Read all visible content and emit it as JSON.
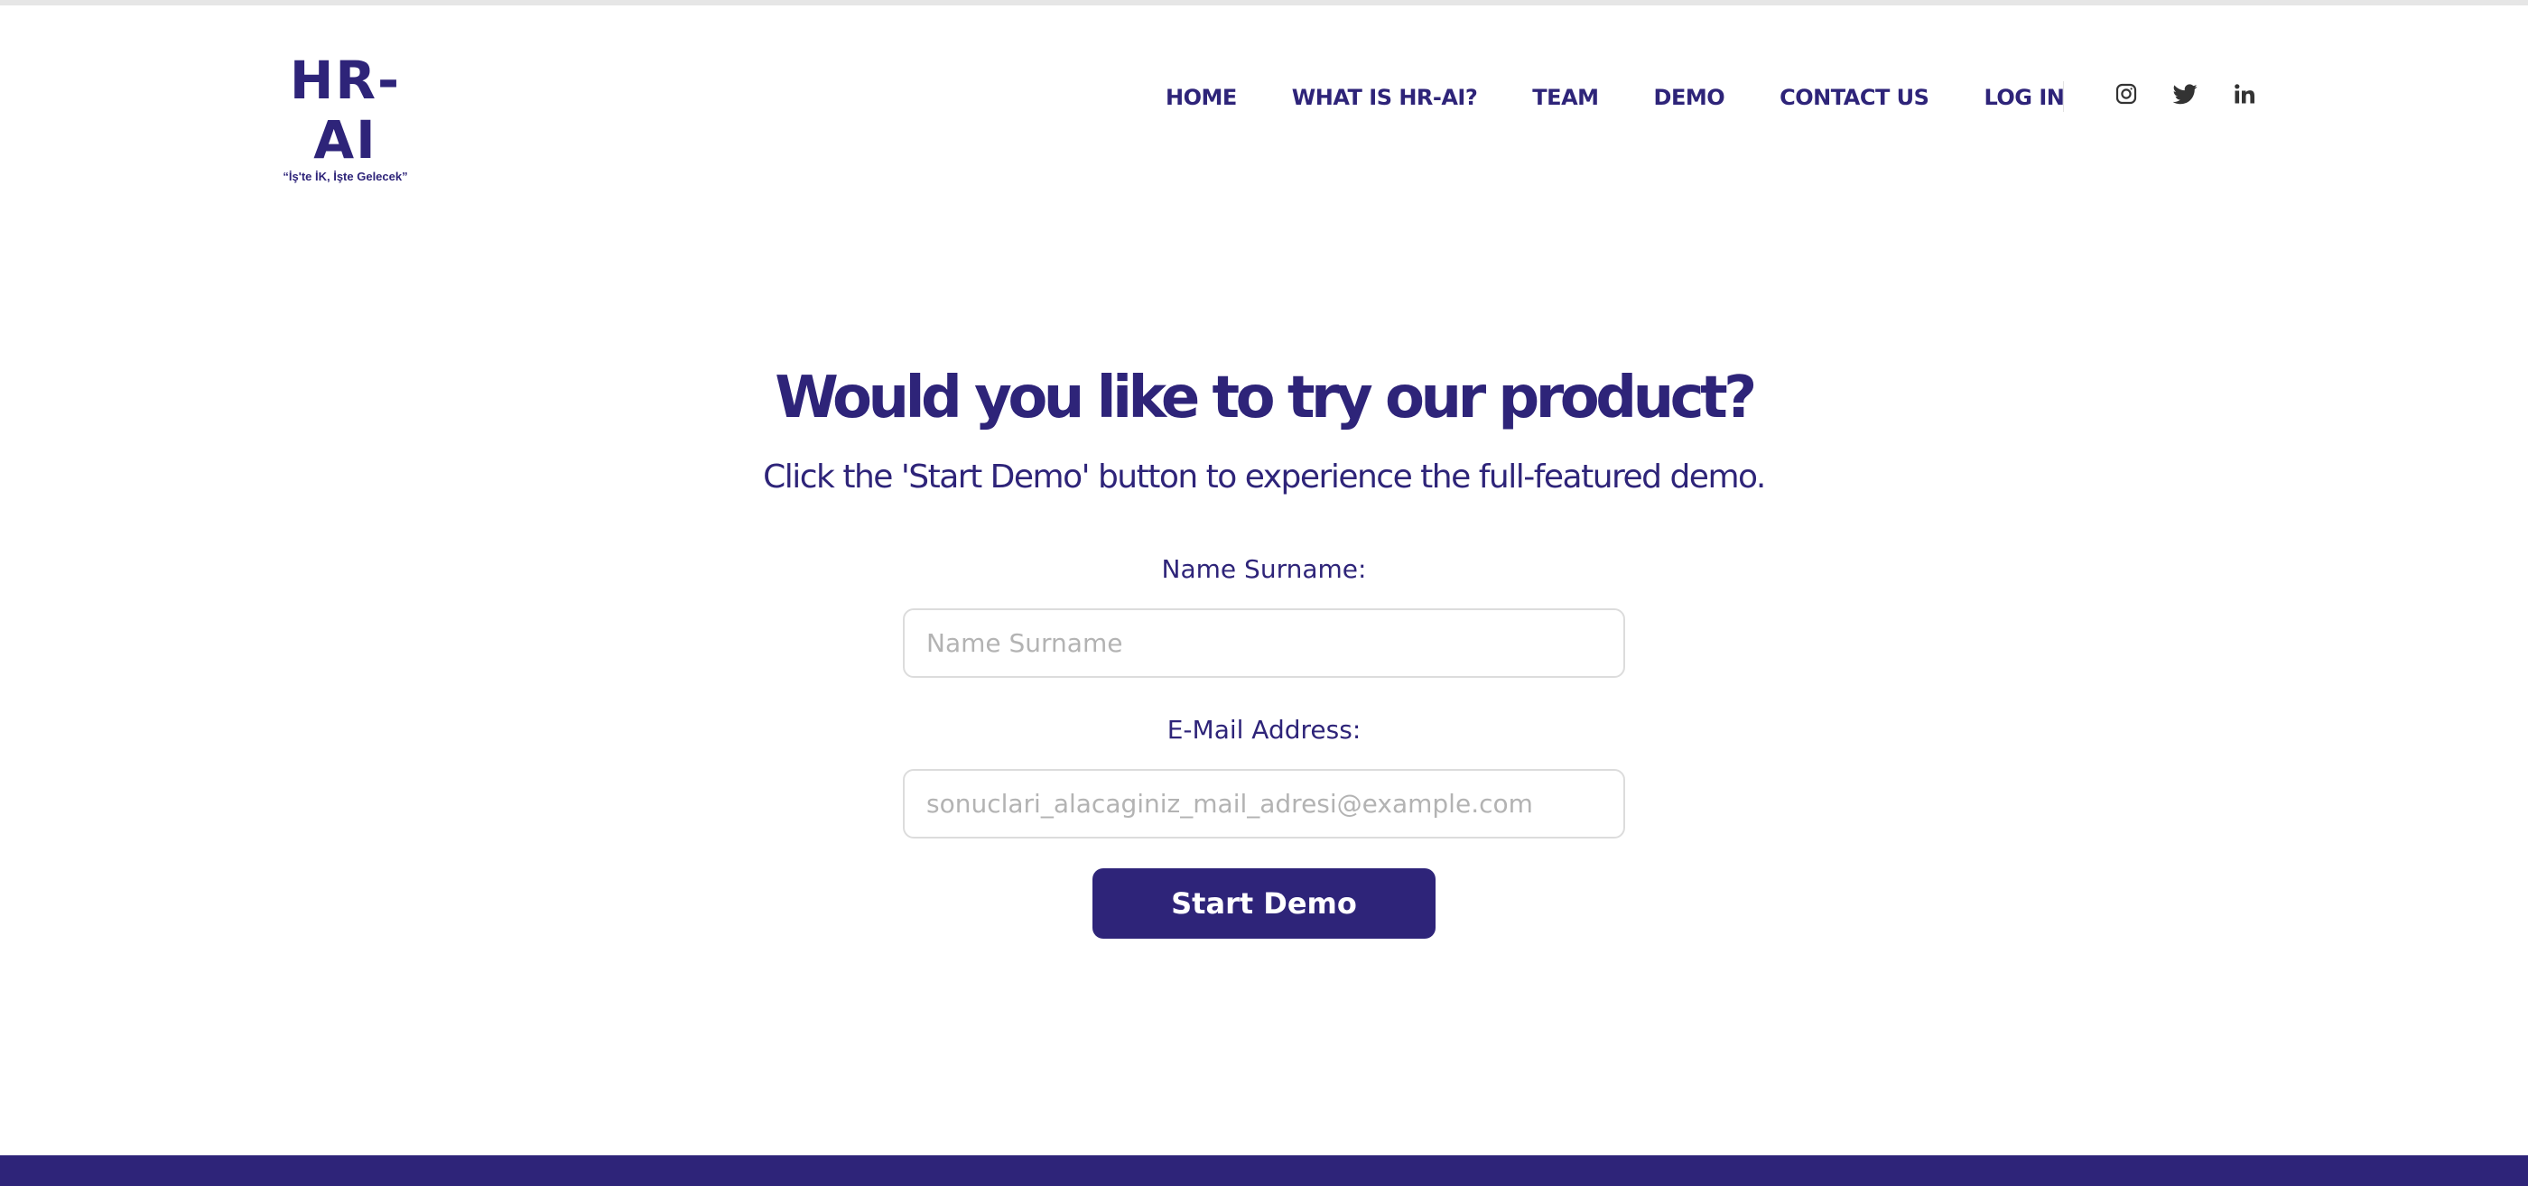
{
  "colors": {
    "brand": "#2e2479",
    "placeholder": "#b3b3b3",
    "input_border": "#dcdcdc",
    "background": "#ffffff"
  },
  "header": {
    "logo": {
      "text": "HR-AI",
      "tagline": "“İş'te İK, İşte Gelecek”"
    },
    "nav": [
      {
        "label": "HOME"
      },
      {
        "label": "WHAT IS HR-AI?"
      },
      {
        "label": "TEAM"
      },
      {
        "label": "DEMO"
      },
      {
        "label": "CONTACT US"
      },
      {
        "label": "LOG IN"
      }
    ],
    "social": [
      "instagram-icon",
      "twitter-icon",
      "linkedin-icon"
    ]
  },
  "main": {
    "title": "Would you like to try our product?",
    "subtitle": "Click the 'Start Demo' button to experience the full-featured demo.",
    "form": {
      "name_label": "Name Surname:",
      "name_placeholder": "Name Surname",
      "name_value": "",
      "email_label": "E-Mail Address:",
      "email_placeholder": "sonuclari_alacaginiz_mail_adresi@example.com",
      "email_value": "",
      "submit_label": "Start Demo"
    }
  }
}
